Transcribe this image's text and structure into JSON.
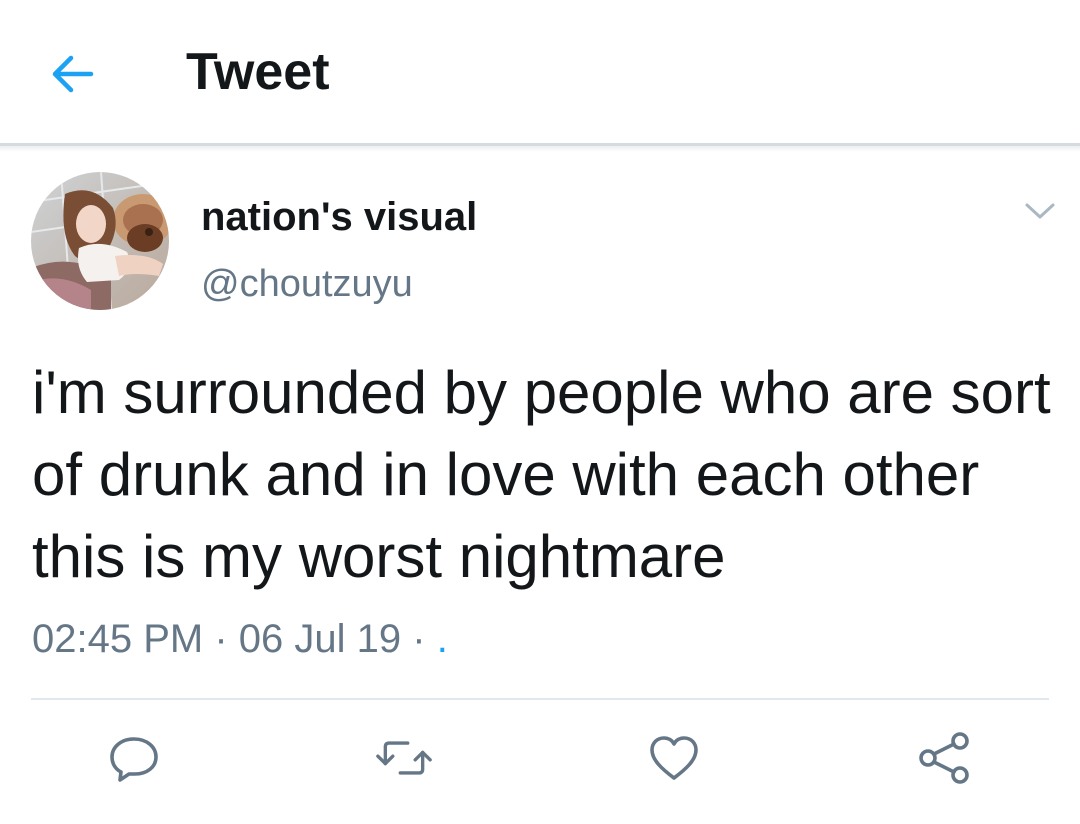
{
  "header": {
    "title": "Tweet",
    "back_icon": "arrow-left-icon",
    "accent_color": "#1da1f2"
  },
  "tweet": {
    "author": {
      "display_name": "nation's visual",
      "handle": "@choutzuyu"
    },
    "text": "i'm surrounded by people who are sort of drunk and in love with each other this is my worst nightmare",
    "time": "02:45 PM",
    "separator": "·",
    "date": "06 Jul 19",
    "trailing_dot": "."
  },
  "actions": [
    {
      "name": "reply",
      "icon": "reply-icon"
    },
    {
      "name": "retweet",
      "icon": "retweet-icon"
    },
    {
      "name": "like",
      "icon": "heart-icon"
    },
    {
      "name": "share",
      "icon": "share-icon"
    }
  ],
  "colors": {
    "text_primary": "#14171a",
    "text_secondary": "#657786",
    "accent": "#1da1f2",
    "divider": "#e1e8ed"
  }
}
